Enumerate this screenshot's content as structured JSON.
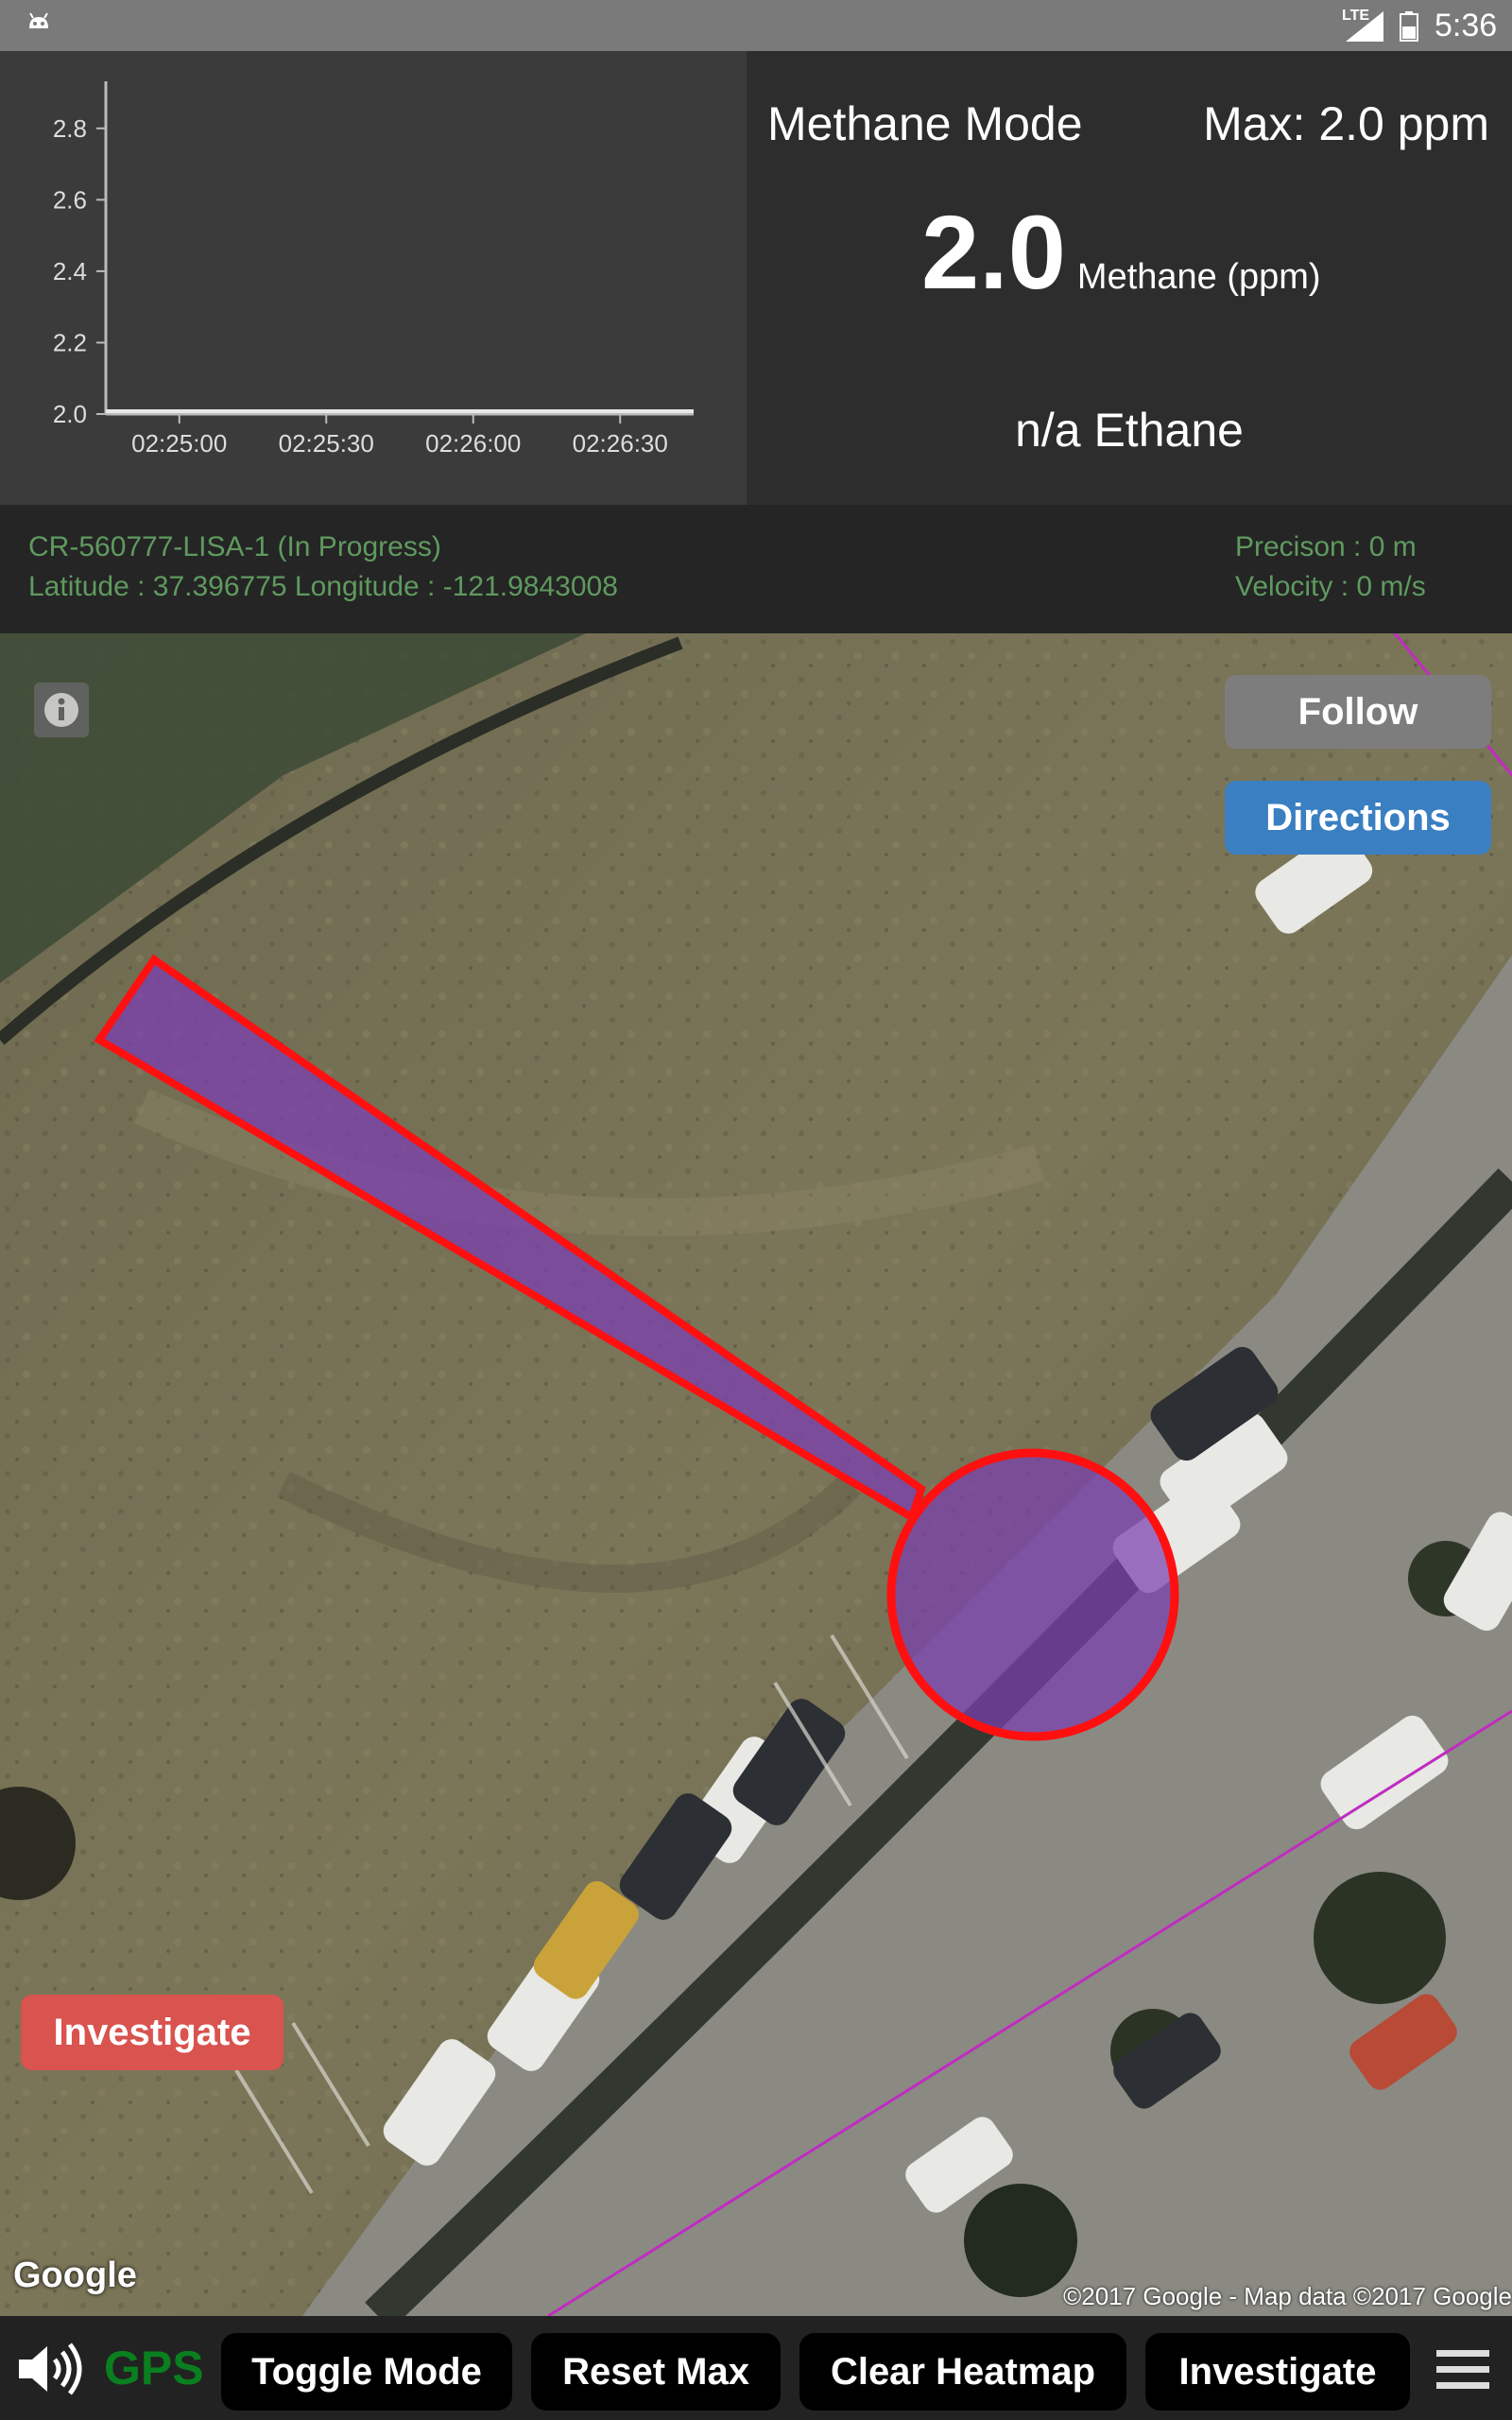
{
  "status_bar": {
    "network": "LTE",
    "time": "5:36"
  },
  "chart_data": {
    "type": "line",
    "x": [
      "02:24:45",
      "02:25:00",
      "02:25:15",
      "02:25:30",
      "02:25:45",
      "02:26:00",
      "02:26:15",
      "02:26:30",
      "02:26:45"
    ],
    "series": [
      {
        "values": [
          2.0,
          2.0,
          2.0,
          2.0,
          2.0,
          2.0,
          2.0,
          2.0,
          2.0
        ]
      }
    ],
    "xticks": [
      "02:25:00",
      "02:25:30",
      "02:26:00",
      "02:26:30"
    ],
    "yticks": [
      "2.0",
      "2.2",
      "2.4",
      "2.6",
      "2.8"
    ],
    "ylim": [
      2.0,
      2.9
    ],
    "grid": false
  },
  "readings": {
    "mode": "Methane Mode",
    "max": "Max: 2.0 ppm",
    "methane_value": "2.0",
    "methane_unit": "Methane (ppm)",
    "ethane": "n/a Ethane"
  },
  "survey": {
    "id_line": "CR-560777-LISA-1  (In Progress)",
    "coords_line": "Latitude : 37.396775  Longitude  :  -121.9843008",
    "precision_line": "Precison : 0  m",
    "velocity_line": "Velocity : 0  m/s"
  },
  "map": {
    "follow_label": "Follow",
    "directions_label": "Directions",
    "investigate_label": "Investigate",
    "google_logo": "Google",
    "copyright": "©2017 Google - Map data ©2017 Google",
    "tile_watermark": "©2017 Google"
  },
  "toolbar": {
    "gps_label": "GPS",
    "toggle_mode": "Toggle Mode",
    "reset_max": "Reset Max",
    "clear_heatmap": "Clear Heatmap",
    "investigate": "Investigate"
  },
  "colors": {
    "accent_blue": "#3a7fc1",
    "investigate_red": "#d9534f",
    "gps_green": "#0a7f1f",
    "plume_purple": "#7b3fb0",
    "outline_red": "#ff1010"
  }
}
